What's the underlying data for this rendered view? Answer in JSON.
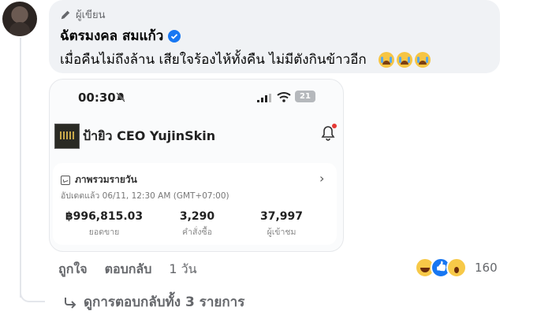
{
  "comment": {
    "author_badge": "ผู้เขียน",
    "author_name": "ฉัตรมงคล สมแก้ว",
    "text": "เมื่อคืนไม่ถึงล้าน เสียใจร้องไห้ทั้งคืน ไม่มีตังกินข้าวอีก",
    "emoji_count": 3,
    "accent_color": "#1877f2"
  },
  "screenshot": {
    "status_time": "00:30",
    "battery": "21",
    "store_name": "ป้ายิว CEO YujinSkin",
    "card_title": "ภาพรวมรายวัน",
    "updated": "อัปเดตแล้ว 06/11, 12:30 AM (GMT+07:00)",
    "stats": [
      {
        "value": "฿996,815.03",
        "label": "ยอดขาย"
      },
      {
        "value": "3,290",
        "label": "คำสั่งซื้อ"
      },
      {
        "value": "37,997",
        "label": "ผู้เข้าชม"
      }
    ]
  },
  "actions": {
    "like": "ถูกใจ",
    "reply": "ตอบกลับ",
    "time": "1 วัน",
    "reaction_count": "160",
    "reaction_icons": [
      "haha-icon",
      "like-icon",
      "wow-icon"
    ]
  },
  "view_replies": "ดูการตอบกลับทั้ง 3 รายการ"
}
